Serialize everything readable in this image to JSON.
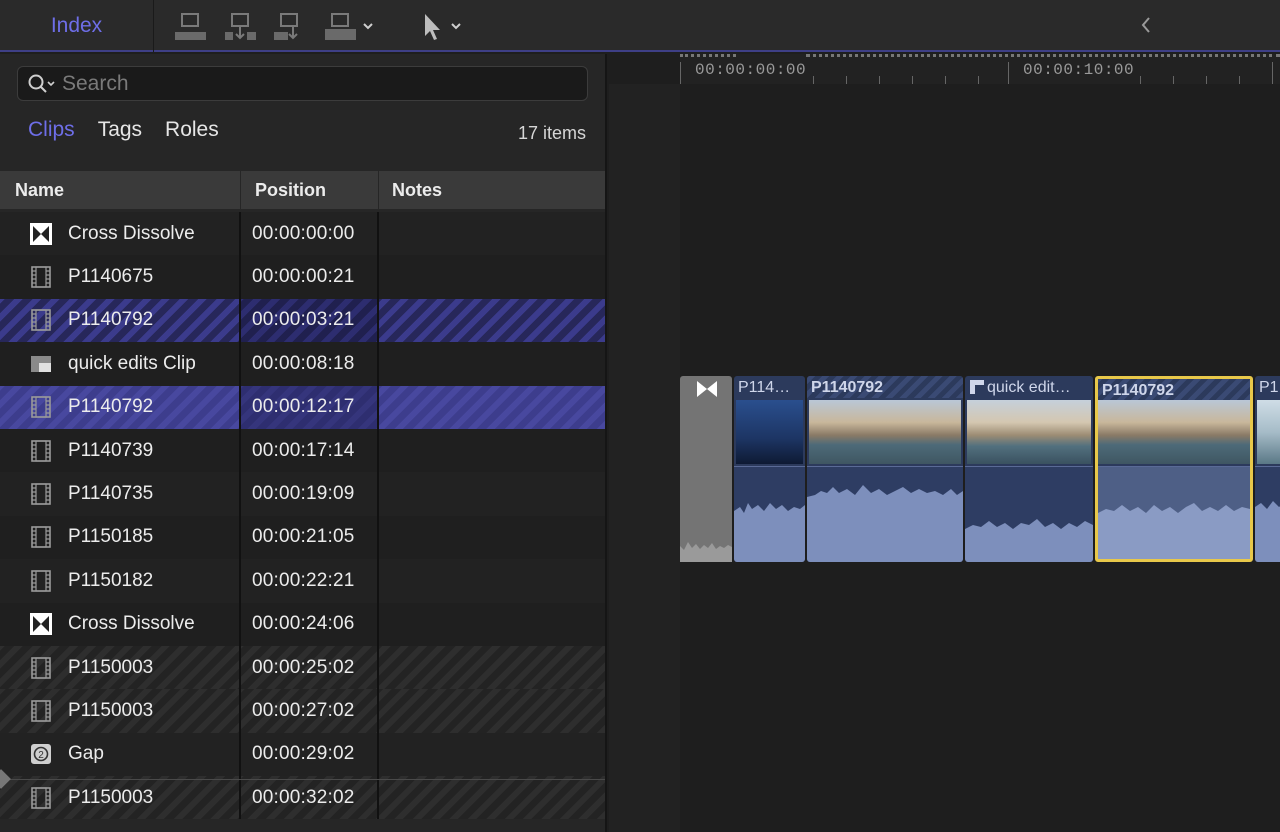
{
  "toolbar": {
    "index_label": "Index"
  },
  "index": {
    "search_placeholder": "Search",
    "tabs": [
      "Clips",
      "Tags",
      "Roles"
    ],
    "active_tab": "Clips",
    "item_count": "17 items",
    "columns": {
      "name": "Name",
      "position": "Position",
      "notes": "Notes"
    },
    "rows": [
      {
        "icon": "transition-icon",
        "name": "Cross Dissolve",
        "position": "00:00:00:00",
        "state": "normal"
      },
      {
        "icon": "film-icon",
        "name": "P1140675",
        "position": "00:00:00:21",
        "state": "normal"
      },
      {
        "icon": "film-icon",
        "name": "P1140792",
        "position": "00:00:03:21",
        "state": "selected-partial"
      },
      {
        "icon": "compound-clip-icon",
        "name": "quick edits Clip",
        "position": "00:00:08:18",
        "state": "normal"
      },
      {
        "icon": "film-icon",
        "name": "P1140792",
        "position": "00:00:12:17",
        "state": "selected"
      },
      {
        "icon": "film-icon",
        "name": "P1140739",
        "position": "00:00:17:14",
        "state": "normal"
      },
      {
        "icon": "film-icon",
        "name": "P1140735",
        "position": "00:00:19:09",
        "state": "normal"
      },
      {
        "icon": "film-icon",
        "name": "P1150185",
        "position": "00:00:21:05",
        "state": "normal"
      },
      {
        "icon": "film-icon",
        "name": "P1150182",
        "position": "00:00:22:21",
        "state": "normal"
      },
      {
        "icon": "transition-icon",
        "name": "Cross Dissolve",
        "position": "00:00:24:06",
        "state": "normal"
      },
      {
        "icon": "film-icon",
        "name": "P1150003",
        "position": "00:00:25:02",
        "state": "gray-stripe"
      },
      {
        "icon": "film-icon",
        "name": "P1150003",
        "position": "00:00:27:02",
        "state": "gray-stripe"
      },
      {
        "icon": "gap-icon",
        "name": "Gap",
        "position": "00:00:29:02",
        "state": "normal"
      },
      {
        "icon": "film-icon",
        "name": "P1150003",
        "position": "00:00:32:02",
        "state": "gray-stripe"
      }
    ]
  },
  "timeline": {
    "ruler_labels": [
      "00:00:00:00",
      "00:00:10:00"
    ],
    "clips": [
      {
        "title": "P114…",
        "selected": false
      },
      {
        "title": "P1140792",
        "selected": false
      },
      {
        "title": "quick edit…",
        "selected": false
      },
      {
        "title": "P1140792",
        "selected": true
      },
      {
        "title": "P1",
        "selected": false
      }
    ]
  },
  "colors": {
    "accent": "#6e6ee8",
    "selection": "#3d3d8d",
    "selected_clip_border": "#e8c84a"
  }
}
